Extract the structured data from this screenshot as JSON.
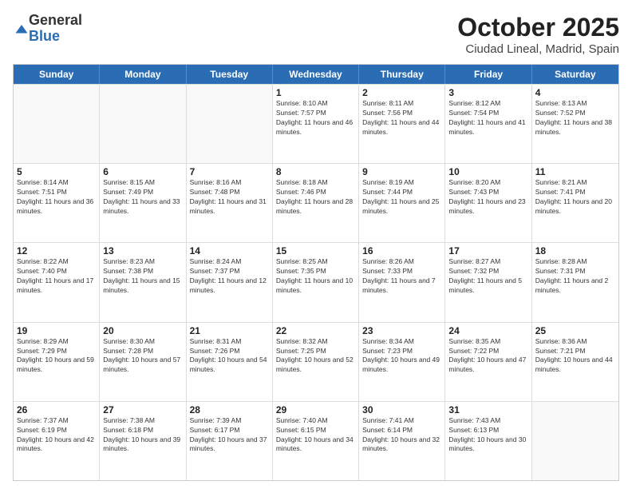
{
  "logo": {
    "general": "General",
    "blue": "Blue"
  },
  "title": "October 2025",
  "subtitle": "Ciudad Lineal, Madrid, Spain",
  "days_of_week": [
    "Sunday",
    "Monday",
    "Tuesday",
    "Wednesday",
    "Thursday",
    "Friday",
    "Saturday"
  ],
  "weeks": [
    [
      {
        "day": "",
        "sunrise": "",
        "sunset": "",
        "daylight": "",
        "empty": true
      },
      {
        "day": "",
        "sunrise": "",
        "sunset": "",
        "daylight": "",
        "empty": true
      },
      {
        "day": "",
        "sunrise": "",
        "sunset": "",
        "daylight": "",
        "empty": true
      },
      {
        "day": "1",
        "sunrise": "Sunrise: 8:10 AM",
        "sunset": "Sunset: 7:57 PM",
        "daylight": "Daylight: 11 hours and 46 minutes."
      },
      {
        "day": "2",
        "sunrise": "Sunrise: 8:11 AM",
        "sunset": "Sunset: 7:56 PM",
        "daylight": "Daylight: 11 hours and 44 minutes."
      },
      {
        "day": "3",
        "sunrise": "Sunrise: 8:12 AM",
        "sunset": "Sunset: 7:54 PM",
        "daylight": "Daylight: 11 hours and 41 minutes."
      },
      {
        "day": "4",
        "sunrise": "Sunrise: 8:13 AM",
        "sunset": "Sunset: 7:52 PM",
        "daylight": "Daylight: 11 hours and 38 minutes."
      }
    ],
    [
      {
        "day": "5",
        "sunrise": "Sunrise: 8:14 AM",
        "sunset": "Sunset: 7:51 PM",
        "daylight": "Daylight: 11 hours and 36 minutes."
      },
      {
        "day": "6",
        "sunrise": "Sunrise: 8:15 AM",
        "sunset": "Sunset: 7:49 PM",
        "daylight": "Daylight: 11 hours and 33 minutes."
      },
      {
        "day": "7",
        "sunrise": "Sunrise: 8:16 AM",
        "sunset": "Sunset: 7:48 PM",
        "daylight": "Daylight: 11 hours and 31 minutes."
      },
      {
        "day": "8",
        "sunrise": "Sunrise: 8:18 AM",
        "sunset": "Sunset: 7:46 PM",
        "daylight": "Daylight: 11 hours and 28 minutes."
      },
      {
        "day": "9",
        "sunrise": "Sunrise: 8:19 AM",
        "sunset": "Sunset: 7:44 PM",
        "daylight": "Daylight: 11 hours and 25 minutes."
      },
      {
        "day": "10",
        "sunrise": "Sunrise: 8:20 AM",
        "sunset": "Sunset: 7:43 PM",
        "daylight": "Daylight: 11 hours and 23 minutes."
      },
      {
        "day": "11",
        "sunrise": "Sunrise: 8:21 AM",
        "sunset": "Sunset: 7:41 PM",
        "daylight": "Daylight: 11 hours and 20 minutes."
      }
    ],
    [
      {
        "day": "12",
        "sunrise": "Sunrise: 8:22 AM",
        "sunset": "Sunset: 7:40 PM",
        "daylight": "Daylight: 11 hours and 17 minutes."
      },
      {
        "day": "13",
        "sunrise": "Sunrise: 8:23 AM",
        "sunset": "Sunset: 7:38 PM",
        "daylight": "Daylight: 11 hours and 15 minutes."
      },
      {
        "day": "14",
        "sunrise": "Sunrise: 8:24 AM",
        "sunset": "Sunset: 7:37 PM",
        "daylight": "Daylight: 11 hours and 12 minutes."
      },
      {
        "day": "15",
        "sunrise": "Sunrise: 8:25 AM",
        "sunset": "Sunset: 7:35 PM",
        "daylight": "Daylight: 11 hours and 10 minutes."
      },
      {
        "day": "16",
        "sunrise": "Sunrise: 8:26 AM",
        "sunset": "Sunset: 7:33 PM",
        "daylight": "Daylight: 11 hours and 7 minutes."
      },
      {
        "day": "17",
        "sunrise": "Sunrise: 8:27 AM",
        "sunset": "Sunset: 7:32 PM",
        "daylight": "Daylight: 11 hours and 5 minutes."
      },
      {
        "day": "18",
        "sunrise": "Sunrise: 8:28 AM",
        "sunset": "Sunset: 7:31 PM",
        "daylight": "Daylight: 11 hours and 2 minutes."
      }
    ],
    [
      {
        "day": "19",
        "sunrise": "Sunrise: 8:29 AM",
        "sunset": "Sunset: 7:29 PM",
        "daylight": "Daylight: 10 hours and 59 minutes."
      },
      {
        "day": "20",
        "sunrise": "Sunrise: 8:30 AM",
        "sunset": "Sunset: 7:28 PM",
        "daylight": "Daylight: 10 hours and 57 minutes."
      },
      {
        "day": "21",
        "sunrise": "Sunrise: 8:31 AM",
        "sunset": "Sunset: 7:26 PM",
        "daylight": "Daylight: 10 hours and 54 minutes."
      },
      {
        "day": "22",
        "sunrise": "Sunrise: 8:32 AM",
        "sunset": "Sunset: 7:25 PM",
        "daylight": "Daylight: 10 hours and 52 minutes."
      },
      {
        "day": "23",
        "sunrise": "Sunrise: 8:34 AM",
        "sunset": "Sunset: 7:23 PM",
        "daylight": "Daylight: 10 hours and 49 minutes."
      },
      {
        "day": "24",
        "sunrise": "Sunrise: 8:35 AM",
        "sunset": "Sunset: 7:22 PM",
        "daylight": "Daylight: 10 hours and 47 minutes."
      },
      {
        "day": "25",
        "sunrise": "Sunrise: 8:36 AM",
        "sunset": "Sunset: 7:21 PM",
        "daylight": "Daylight: 10 hours and 44 minutes."
      }
    ],
    [
      {
        "day": "26",
        "sunrise": "Sunrise: 7:37 AM",
        "sunset": "Sunset: 6:19 PM",
        "daylight": "Daylight: 10 hours and 42 minutes."
      },
      {
        "day": "27",
        "sunrise": "Sunrise: 7:38 AM",
        "sunset": "Sunset: 6:18 PM",
        "daylight": "Daylight: 10 hours and 39 minutes."
      },
      {
        "day": "28",
        "sunrise": "Sunrise: 7:39 AM",
        "sunset": "Sunset: 6:17 PM",
        "daylight": "Daylight: 10 hours and 37 minutes."
      },
      {
        "day": "29",
        "sunrise": "Sunrise: 7:40 AM",
        "sunset": "Sunset: 6:15 PM",
        "daylight": "Daylight: 10 hours and 34 minutes."
      },
      {
        "day": "30",
        "sunrise": "Sunrise: 7:41 AM",
        "sunset": "Sunset: 6:14 PM",
        "daylight": "Daylight: 10 hours and 32 minutes."
      },
      {
        "day": "31",
        "sunrise": "Sunrise: 7:43 AM",
        "sunset": "Sunset: 6:13 PM",
        "daylight": "Daylight: 10 hours and 30 minutes."
      },
      {
        "day": "",
        "sunrise": "",
        "sunset": "",
        "daylight": "",
        "empty": true
      }
    ]
  ]
}
